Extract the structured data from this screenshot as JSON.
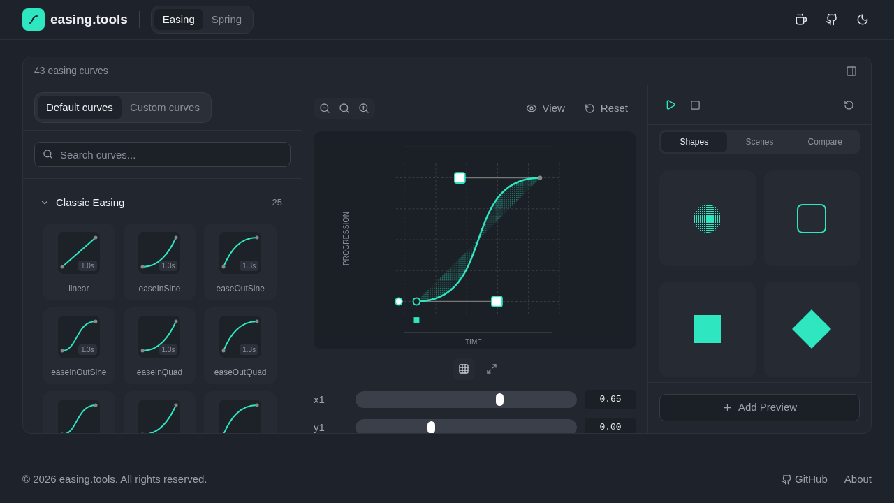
{
  "header": {
    "brand": "easing.tools",
    "modes": [
      {
        "label": "Easing",
        "selected": true
      },
      {
        "label": "Spring",
        "selected": false
      }
    ]
  },
  "workspace": {
    "count_label": "43 easing curves",
    "library": {
      "tabs": [
        {
          "label": "Default curves",
          "selected": true
        },
        {
          "label": "Custom curves",
          "selected": false
        }
      ],
      "search": {
        "placeholder": "Search curves..."
      },
      "group": {
        "title": "Classic Easing",
        "count": "25",
        "expanded": true,
        "curves": [
          {
            "name": "linear",
            "duration": "1.0s",
            "kind": "linear"
          },
          {
            "name": "easeInSine",
            "duration": "1.3s",
            "kind": "in"
          },
          {
            "name": "easeOutSine",
            "duration": "1.3s",
            "kind": "out"
          },
          {
            "name": "easeInOutSine",
            "duration": "1.3s",
            "kind": "inout"
          },
          {
            "name": "easeInQuad",
            "duration": "1.3s",
            "kind": "in"
          },
          {
            "name": "easeOutQuad",
            "duration": "1.3s",
            "kind": "out"
          },
          {
            "kind": "inout"
          },
          {
            "kind": "in"
          },
          {
            "kind": "out"
          }
        ]
      }
    },
    "editor": {
      "view_label": "View",
      "reset_label": "Reset",
      "x_axis": "TIME",
      "y_axis": "PROGRESSION",
      "params": [
        {
          "label": "x1",
          "level": 0.65,
          "value": "0.65"
        },
        {
          "label": "y1",
          "level": 0.34,
          "value": "0.00"
        }
      ]
    },
    "preview": {
      "tabs": [
        {
          "label": "Shapes",
          "selected": true
        },
        {
          "label": "Scenes",
          "selected": false
        },
        {
          "label": "Compare",
          "selected": false
        }
      ],
      "shapes": [
        {
          "kind": "dotted-circle"
        },
        {
          "kind": "outline-square"
        },
        {
          "kind": "square"
        },
        {
          "kind": "diamond"
        }
      ],
      "add_label": "Add Preview"
    }
  },
  "footer": {
    "copyright": "© 2026 easing.tools. All rights reserved.",
    "links": [
      "GitHub",
      "About"
    ]
  }
}
